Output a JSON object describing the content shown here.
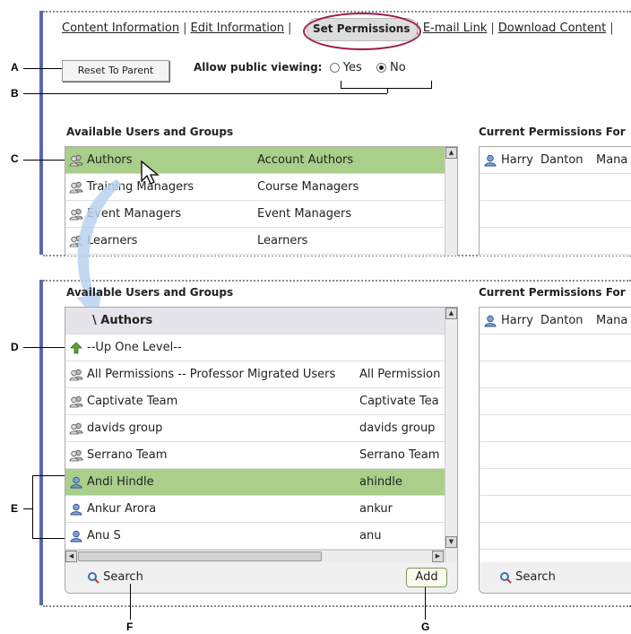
{
  "nav": {
    "links": [
      "Content Information",
      "Edit Information",
      "Set Permissions",
      "E-mail Link",
      "Download Content"
    ],
    "separator": "|"
  },
  "reset_button": "Reset To Parent",
  "public_viewing": {
    "label": "Allow public viewing:",
    "yes": "Yes",
    "no": "No",
    "selected": "No"
  },
  "callouts": [
    "A",
    "B",
    "C",
    "D",
    "E",
    "F",
    "G"
  ],
  "top_panel": {
    "left_title": "Available Users and Groups",
    "right_title": "Current Permissions For",
    "rows": [
      {
        "name": "Authors",
        "desc": "Account Authors",
        "icon": "group-icon",
        "selected": true
      },
      {
        "name": "Training Managers",
        "desc": "Course Managers",
        "icon": "group-icon",
        "selected": false
      },
      {
        "name": "Event Managers",
        "desc": "Event Managers",
        "icon": "group-icon",
        "selected": false
      },
      {
        "name": "Learners",
        "desc": "Learners",
        "icon": "group-icon",
        "selected": false
      }
    ],
    "current": [
      {
        "first": "Harry",
        "last": "Danton",
        "role": "Mana"
      }
    ]
  },
  "bottom_panel": {
    "left_title": "Available Users and Groups",
    "right_title": "Current Permissions For",
    "breadcrumb": "\\ Authors",
    "up_level": "--Up One Level--",
    "rows": [
      {
        "name": "All Permissions -- Professor Migrated Users",
        "desc": "All Permission",
        "icon": "group-icon",
        "selected": false
      },
      {
        "name": "Captivate Team",
        "desc": "Captivate Tea",
        "icon": "group-icon",
        "selected": false
      },
      {
        "name": "davids group",
        "desc": "davids group",
        "icon": "group-icon",
        "selected": false
      },
      {
        "name": "Serrano Team",
        "desc": "Serrano Team",
        "icon": "group-icon",
        "selected": false
      },
      {
        "name": "Andi Hindle",
        "desc": "ahindle",
        "icon": "user-icon",
        "selected": true
      },
      {
        "name": "Ankur Arora",
        "desc": "ankur",
        "icon": "user-icon",
        "selected": false
      },
      {
        "name": "Anu S",
        "desc": "anu",
        "icon": "user-icon",
        "selected": false
      }
    ],
    "current": [
      {
        "first": "Harry",
        "last": "Danton",
        "role": "Mana"
      }
    ],
    "search_label": "Search",
    "add_label": "Add",
    "right_search_label": "Search"
  },
  "colors": {
    "accent_bar": "#5a6aa8",
    "selected_row": "#a9cf8a",
    "highlight_oval": "#a01850"
  }
}
